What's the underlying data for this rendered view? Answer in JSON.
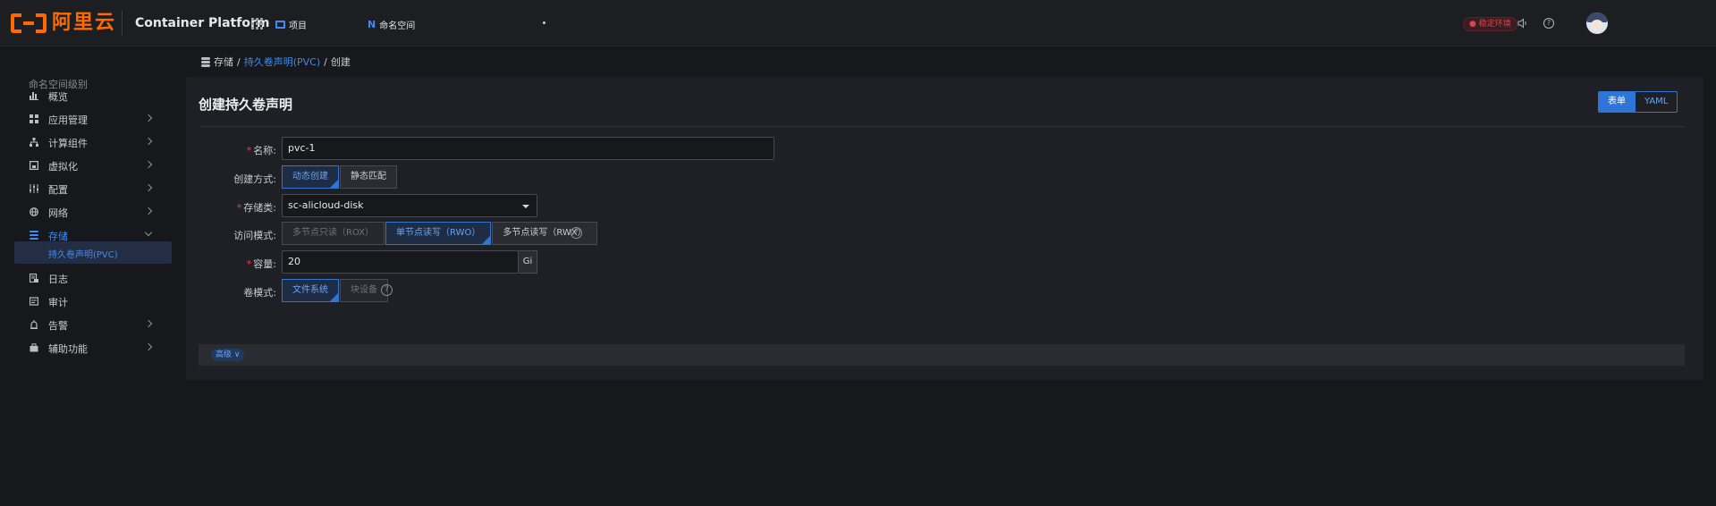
{
  "header": {
    "brand_text": "阿里云",
    "platform_title": "Container Platform",
    "project_label": "项目",
    "namespace_label": "命名空间",
    "namespace_icon_letter": "N",
    "status_badge": "● 稳定环境",
    "help_glyph": "?"
  },
  "sidebar": {
    "heading": "命名空间级别",
    "items": [
      {
        "label": "概览",
        "icon": "bar-chart-icon",
        "has_children": false
      },
      {
        "label": "应用管理",
        "icon": "grid-icon",
        "has_children": true
      },
      {
        "label": "计算组件",
        "icon": "hierarchy-icon",
        "has_children": true
      },
      {
        "label": "虚拟化",
        "icon": "vm-icon",
        "has_children": true
      },
      {
        "label": "配置",
        "icon": "sliders-icon",
        "has_children": true
      },
      {
        "label": "网络",
        "icon": "globe-icon",
        "has_children": true
      },
      {
        "label": "存储",
        "icon": "database-icon",
        "has_children": true,
        "expanded": true,
        "active": true
      },
      {
        "label": "日志",
        "icon": "log-icon",
        "has_children": false
      },
      {
        "label": "审计",
        "icon": "audit-icon",
        "has_children": false
      },
      {
        "label": "告警",
        "icon": "alarm-icon",
        "has_children": true
      },
      {
        "label": "辅助功能",
        "icon": "toolbox-icon",
        "has_children": true
      }
    ],
    "sub_item_active": "持久卷声明(PVC)"
  },
  "breadcrumb": {
    "root": "存储",
    "sep1": "/",
    "link": "持久卷声明(PVC)",
    "sep2": "/",
    "current": "创建"
  },
  "page": {
    "title": "创建持久卷声明",
    "mode_form": "表单",
    "mode_yaml": "YAML"
  },
  "form": {
    "required_mark": "*",
    "name": {
      "label": "名称:",
      "value": "pvc-1"
    },
    "create_method": {
      "label": "创建方式:",
      "options": [
        "动态创建",
        "静态匹配"
      ],
      "selected": "动态创建"
    },
    "storage_class": {
      "label": "存储类:",
      "value": "sc-alicloud-disk"
    },
    "access_mode": {
      "label": "访问模式:",
      "options": [
        "多节点只读（ROX）",
        "单节点读写（RWO）",
        "多节点读写（RWX）"
      ],
      "selected": "单节点读写（RWO）"
    },
    "capacity": {
      "label": "容量:",
      "value": "20",
      "unit": "Gi"
    },
    "volume_mode": {
      "label": "卷模式:",
      "options": [
        "文件系统",
        "块设备"
      ],
      "selected": "文件系统"
    },
    "advanced_label": "高级 ∨",
    "help_glyph": "?"
  },
  "colors": {
    "accent": "#2f75d6",
    "brand": "#ff6a00",
    "required": "#e04545",
    "background": "#17181c",
    "card": "#1f2025"
  }
}
